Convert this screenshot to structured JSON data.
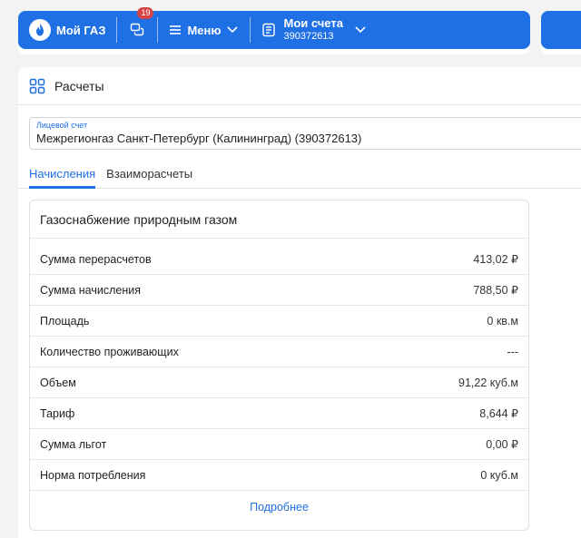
{
  "header": {
    "brand": "Мой ГАЗ",
    "notifications_count": "19",
    "menu_label": "Меню",
    "account_title": "Мои счета",
    "account_number": "390372613",
    "brand_color": "#1f6fe5"
  },
  "page": {
    "title": "Расчеты"
  },
  "account_field": {
    "label": "Лицевой счет",
    "value": "Межрегионгаз Санкт-Петербург (Калининград) (390372613)"
  },
  "tabs": [
    {
      "label": "Начисления",
      "active": true
    },
    {
      "label": "Взаиморасчеты",
      "active": false
    }
  ],
  "service": {
    "title": "Газоснабжение природным газом",
    "rows": [
      {
        "label": "Сумма перерасчетов",
        "value": "413,02 ₽"
      },
      {
        "label": "Сумма начисления",
        "value": "788,50 ₽"
      },
      {
        "label": "Площадь",
        "value": "0 кв.м"
      },
      {
        "label": "Количество проживающих",
        "value": "---"
      },
      {
        "label": "Объем",
        "value": "91,22 куб.м"
      },
      {
        "label": "Тариф",
        "value": "8,644 ₽"
      },
      {
        "label": "Сумма льгот",
        "value": "0,00 ₽"
      },
      {
        "label": "Норма потребления",
        "value": "0 куб.м"
      }
    ],
    "more_label": "Подробнее"
  }
}
